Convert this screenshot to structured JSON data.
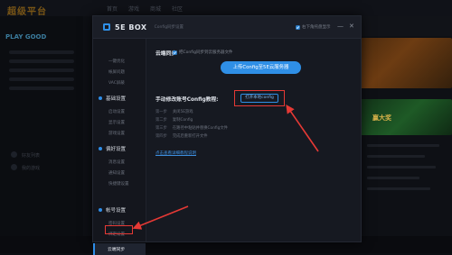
{
  "background": {
    "logo": "超级平台",
    "nav": [
      "首页",
      "游戏",
      "商城",
      "社区"
    ],
    "play_label": "PLAY GOOD",
    "side_labels": [
      "好友列表",
      "我的游戏"
    ],
    "banner_text": [
      "",
      "赢大奖"
    ]
  },
  "modal": {
    "brand": "5E BOX",
    "subtitle": "Config同步设置",
    "tray_label": "右下角托盘显示",
    "ctrl_min": "—",
    "ctrl_close": "✕",
    "nav": {
      "top_items": [
        "一键优化",
        "帐屏问题",
        "VAC屏蔽"
      ],
      "groups": [
        {
          "label": "基础设置",
          "items": [
            "启动设置",
            "显示设置",
            "游戏设置"
          ]
        },
        {
          "label": "偏好设置",
          "items": [
            "消息设置",
            "通知设置",
            "快捷键设置"
          ]
        },
        {
          "label": "帐号设置",
          "items": [
            "密码设置",
            "绑定设置"
          ]
        }
      ],
      "active": "云端同步"
    },
    "content": {
      "title": "云端同步",
      "desc": "把Config同步到云服务器文件",
      "upload_button": "上传Config至5E云服务器",
      "tutorial_title": "手动修改账号Config教程:",
      "open_button": "打开本地config",
      "steps": [
        {
          "no": "第一步",
          "text": "关闭5E游戏"
        },
        {
          "no": "第二步",
          "text": "复制Config"
        },
        {
          "no": "第三步",
          "text": "在路径中粘贴并替换Config文件"
        },
        {
          "no": "第四步",
          "text": "完成后重新打开文件"
        }
      ],
      "help_link": "点击查看详细教程说明"
    }
  },
  "colors": {
    "accent": "#2f8fe6",
    "annotation": "#e53935"
  }
}
